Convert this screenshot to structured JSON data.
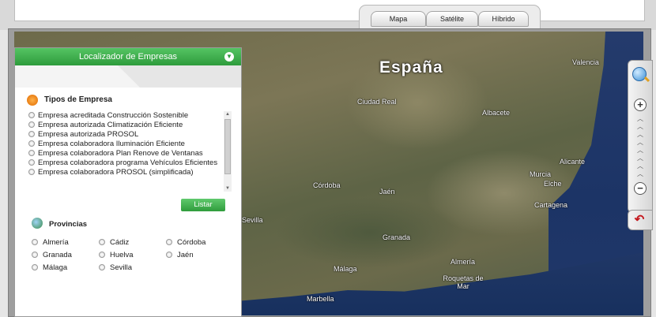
{
  "map_types": {
    "tabs": [
      {
        "label": "Mapa"
      },
      {
        "label": "Satélite"
      },
      {
        "label": "Híbrido"
      }
    ]
  },
  "map": {
    "country": "España",
    "cities": [
      "Valencia",
      "Ciudad Real",
      "Albacete",
      "Alicante",
      "Murcia",
      "Córdoba",
      "Jaén",
      "Elche",
      "Sevilla",
      "Granada",
      "Cartagena",
      "Almería",
      "Málaga",
      "Roquetas de Mar",
      "Marbella"
    ]
  },
  "panel": {
    "title": "Localizador de Empresas",
    "tipos": {
      "title": "Tipos de Empresa",
      "items": [
        "Empresa acreditada Construcción Sostenible",
        "Empresa autorizada Climatización Eficiente",
        "Empresa autorizada PROSOL",
        "Empresa colaboradora Iluminación Eficiente",
        "Empresa colaboradora Plan Renove de Ventanas",
        "Empresa colaboradora programa Vehículos Eficientes",
        "Empresa colaboradora PROSOL (simplificada)"
      ]
    },
    "listar_label": "Listar",
    "provincias": {
      "title": "Provincias",
      "items": [
        "Almería",
        "Cádiz",
        "Córdoba",
        "Granada",
        "Huelva",
        "Jaén",
        "Málaga",
        "Sevilla"
      ]
    }
  },
  "colors": {
    "accent_green": "#2e9b3c",
    "sea": "#1c3466"
  }
}
